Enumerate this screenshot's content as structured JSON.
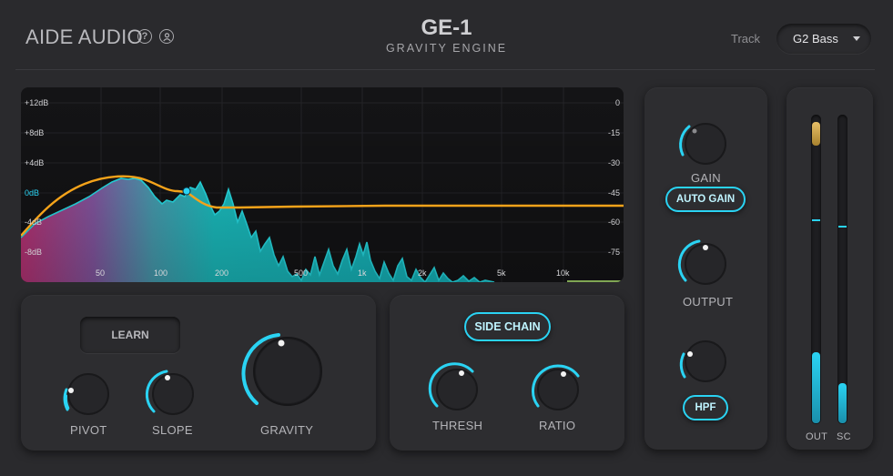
{
  "header": {
    "brand": "AIDE AUDIO",
    "help_icon_glyph": "?",
    "title": "GE-1",
    "subtitle": "GRAVITY ENGINE",
    "track_label": "Track",
    "track_value": "G2 Bass"
  },
  "analyzer": {
    "db_labels_left": [
      "+12dB",
      "+8dB",
      "+4dB",
      "0dB",
      "-4dB",
      "-8dB"
    ],
    "db_labels_right": [
      "0",
      "-15",
      "-30",
      "-45",
      "-60",
      "-75"
    ],
    "freq_labels": [
      "50",
      "100",
      "200",
      "500",
      "1k",
      "2k",
      "5k",
      "10k"
    ]
  },
  "controls": {
    "learn_label": "LEARN",
    "pivot_label": "PIVOT",
    "slope_label": "SLOPE",
    "gravity_label": "GRAVITY",
    "sidechain_label": "SIDE CHAIN",
    "thresh_label": "THRESH",
    "ratio_label": "RATIO",
    "gain_label": "GAIN",
    "autogain_label": "AUTO GAIN",
    "output_label": "OUTPUT",
    "hpf_label": "HPF"
  },
  "meters": {
    "out_label": "OUT",
    "sc_label": "SC",
    "out_level": 0.23,
    "sc_level": 0.13,
    "out_peak": 0.66,
    "sc_peak": 0.64
  },
  "colors": {
    "accent": "#2ad3f3",
    "curve": "#f5a31a",
    "background": "#2a2a2d"
  }
}
